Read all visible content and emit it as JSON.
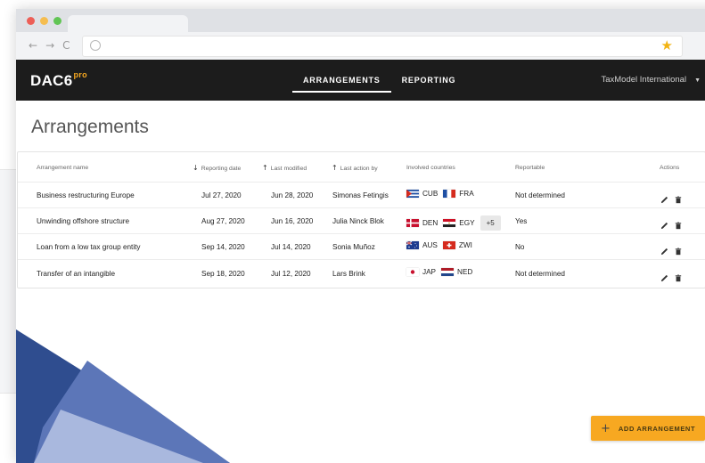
{
  "window": {
    "traffic_colors": [
      "#ed5f57",
      "#f5bd4f",
      "#61c554"
    ],
    "expand_glyph": "⤢"
  },
  "toolbar": {
    "back_glyph": "←",
    "forward_glyph": "→",
    "reload_glyph": "C",
    "star_glyph": "★"
  },
  "appbar": {
    "logo_text": "DAC6",
    "logo_sup": "pro",
    "nav": [
      "ARRANGEMENTS",
      "REPORTING"
    ],
    "active_nav": "ARRANGEMENTS",
    "org_name": "TaxModel International",
    "org_caret": "▼"
  },
  "page": {
    "title": "Arrangements"
  },
  "table": {
    "headers": {
      "name": "Arrangement name",
      "reporting_date": "Reporting date",
      "last_modified": "Last modified",
      "last_action_by": "Last action by",
      "countries": "Involved countries",
      "reportable": "Reportable",
      "actions": "Actions"
    },
    "sort_glyphs": {
      "reporting_date": "↓",
      "last_modified": "↑",
      "last_action_by": "↑"
    },
    "rows": [
      {
        "name": "Business restructuring Europe",
        "reporting_date": "Jul 27, 2020",
        "last_modified": "Jun 28, 2020",
        "last_action_by": "Simonas Fetingis",
        "countries": [
          {
            "code": "CUB",
            "flag": "cuba"
          },
          {
            "code": "FRA",
            "flag": "france"
          }
        ],
        "more": "",
        "reportable": "Not determined"
      },
      {
        "name": "Unwinding offshore structure",
        "reporting_date": "Aug 27, 2020",
        "last_modified": "Jun 16, 2020",
        "last_action_by": "Julia Ninck Blok",
        "countries": [
          {
            "code": "DEN",
            "flag": "denmark"
          },
          {
            "code": "EGY",
            "flag": "egypt"
          }
        ],
        "more": "+5",
        "reportable": "Yes"
      },
      {
        "name": "Loan from a low tax group entity",
        "reporting_date": "Sep 14, 2020",
        "last_modified": "Jul 14, 2020",
        "last_action_by": "Sonia Muñoz",
        "countries": [
          {
            "code": "AUS",
            "flag": "australia"
          },
          {
            "code": "ZWI",
            "flag": "switzerland"
          }
        ],
        "more": "",
        "reportable": "No"
      },
      {
        "name": "Transfer of an intangible",
        "reporting_date": "Sep 18, 2020",
        "last_modified": "Jul 12, 2020",
        "last_action_by": "Lars Brink",
        "countries": [
          {
            "code": "JAP",
            "flag": "japan"
          },
          {
            "code": "NED",
            "flag": "netherlands"
          }
        ],
        "more": "",
        "reportable": "Not determined"
      }
    ]
  },
  "fab": {
    "plus_glyph": "+",
    "label": "ADD ARRANGEMENT"
  },
  "colors": {
    "accent": "#f7a821",
    "appbar": "#1c1c1c",
    "deco_dark": "#2f4d8f",
    "deco_mid": "#5c76b8",
    "deco_light": "#a9b8de"
  }
}
